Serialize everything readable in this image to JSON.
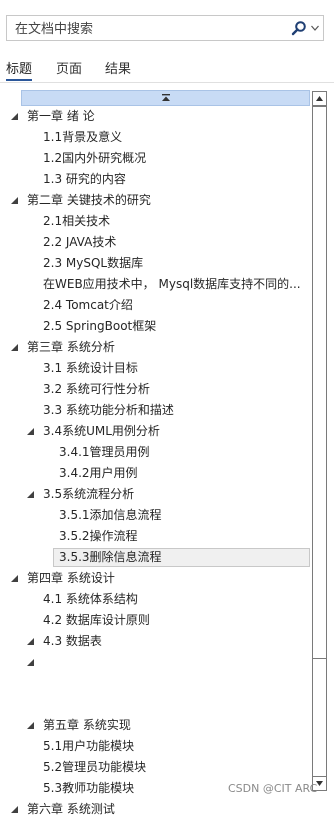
{
  "search": {
    "placeholder": "在文档中搜索"
  },
  "tabs": [
    {
      "label": "标题",
      "active": true
    },
    {
      "label": "页面",
      "active": false
    },
    {
      "label": "结果",
      "active": false
    }
  ],
  "tree": [
    {
      "label": "第一章 绪 论",
      "level": 1,
      "expanded": true
    },
    {
      "label": "1.1背景及意义",
      "level": 2
    },
    {
      "label": "1.2国内外研究概况",
      "level": 2
    },
    {
      "label": "1.3 研究的内容",
      "level": 2
    },
    {
      "label": "第二章 关键技术的研究",
      "level": 1,
      "expanded": true
    },
    {
      "label": "2.1相关技术",
      "level": 2
    },
    {
      "label": "2.2 JAVA技术",
      "level": 2
    },
    {
      "label": "2.3 MySQL数据库",
      "level": 2
    },
    {
      "label": "在WEB应用技术中，  Mysql数据库支持不同的...",
      "level": 2
    },
    {
      "label": "2.4 Tomcat介绍",
      "level": 2
    },
    {
      "label": "2.5 SpringBoot框架",
      "level": 2
    },
    {
      "label": "第三章 系统分析",
      "level": 1,
      "expanded": true
    },
    {
      "label": "3.1 系统设计目标",
      "level": 2
    },
    {
      "label": "3.2 系统可行性分析",
      "level": 2
    },
    {
      "label": "3.3 系统功能分析和描述",
      "level": 2
    },
    {
      "label": "3.4系统UML用例分析",
      "level": 2,
      "expanded": true
    },
    {
      "label": "3.4.1管理员用例",
      "level": 3
    },
    {
      "label": "3.4.2用户用例",
      "level": 3
    },
    {
      "label": "3.5系统流程分析",
      "level": 2,
      "expanded": true
    },
    {
      "label": "3.5.1添加信息流程",
      "level": 3
    },
    {
      "label": "3.5.2操作流程",
      "level": 3
    },
    {
      "label": "3.5.3删除信息流程",
      "level": 3,
      "selected": true
    },
    {
      "label": "第四章 系统设计",
      "level": 1,
      "expanded": true
    },
    {
      "label": "4.1 系统体系结构",
      "level": 2
    },
    {
      "label": "4.2 数据库设计原则",
      "level": 2
    },
    {
      "label": "4.3 数据表",
      "level": 2,
      "expanded": true
    },
    {
      "label": "",
      "level": 2,
      "expanded": true
    },
    {
      "label": "",
      "level": 0
    },
    {
      "label": "",
      "level": 0
    },
    {
      "label": "第五章 系统实现",
      "level": 2,
      "expanded": true
    },
    {
      "label": "5.1用户功能模块",
      "level": 2
    },
    {
      "label": "5.2管理员功能模块",
      "level": 2
    },
    {
      "label": "5.3教师功能模块",
      "level": 2
    },
    {
      "label": "第六章  系统测试",
      "level": 1,
      "expanded": true
    }
  ],
  "watermark": "CSDN @CIT ARC",
  "colors": {
    "accent": "#2b579a",
    "collapse_bar": "#c8dbf5"
  }
}
